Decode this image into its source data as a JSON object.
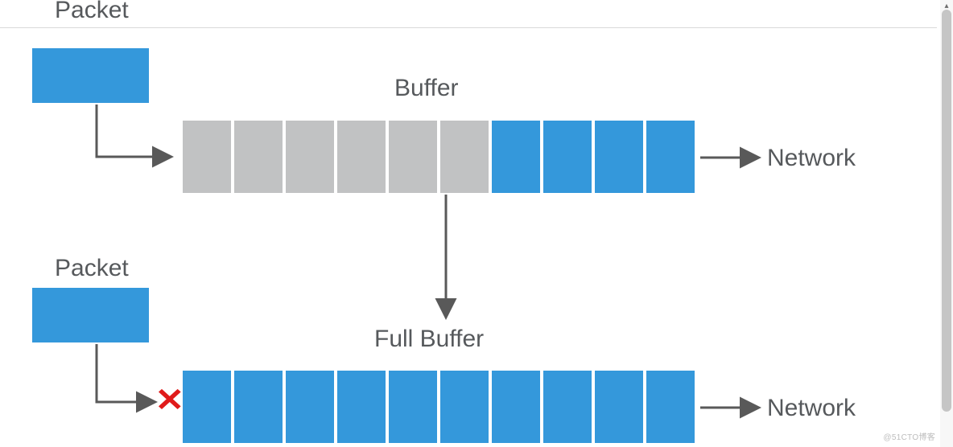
{
  "colors": {
    "packet_blue": "#3498db",
    "buffer_empty": "#c1c2c3",
    "text": "#56595c",
    "cross": "#e01b1b",
    "arrow": "#595959"
  },
  "top": {
    "packet_label": "Packet",
    "buffer_label": "Buffer",
    "network_label": "Network",
    "slots": [
      "empty",
      "empty",
      "empty",
      "empty",
      "empty",
      "empty",
      "full",
      "full",
      "full",
      "full"
    ]
  },
  "bottom": {
    "packet_label": "Packet",
    "buffer_label": "Full Buffer",
    "network_label": "Network",
    "slots": [
      "full",
      "full",
      "full",
      "full",
      "full",
      "full",
      "full",
      "full",
      "full",
      "full"
    ],
    "cross": "✕"
  },
  "watermark": "@51CTO博客"
}
